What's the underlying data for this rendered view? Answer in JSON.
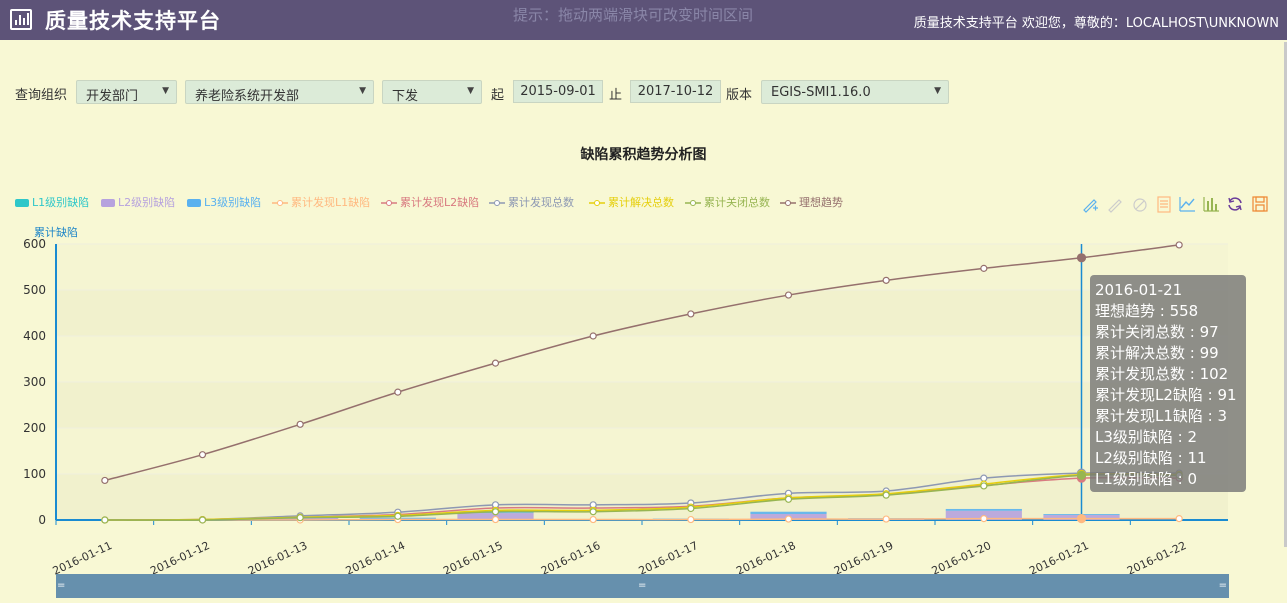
{
  "header": {
    "title": "质量技术支持平台",
    "hint": "提示：拖动两端滑块可改变时间区间",
    "user_info": "质量技术支持平台 欢迎您，尊敬的：LOCALHOST\\UNKNOWN"
  },
  "filters": {
    "org_label": "查询组织",
    "dept_type": "开发部门",
    "dept": "养老险系统开发部",
    "status": "下发",
    "start_label": "起",
    "start_date": "2015-09-01",
    "end_label": "止",
    "end_date": "2017-10-12",
    "version_label": "版本",
    "version": "EGIS-SMI1.16.0"
  },
  "toolbox_icons": [
    "zoom-icon",
    "zoom-reset-icon",
    "restore-icon",
    "data-view-icon",
    "line-chart-icon",
    "bar-chart-icon",
    "refresh-icon",
    "save-image-icon"
  ],
  "chart_data": {
    "type": "line",
    "title": "缺陷累积趋势分析图",
    "ylabel": "累计缺陷",
    "ylim": [
      0,
      600
    ],
    "yticks": [
      0,
      100,
      200,
      300,
      400,
      500,
      600
    ],
    "grid": true,
    "legend_position": "top-left",
    "categories": [
      "2016-01-11",
      "2016-01-12",
      "2016-01-13",
      "2016-01-14",
      "2016-01-15",
      "2016-01-16",
      "2016-01-17",
      "2016-01-18",
      "2016-01-19",
      "2016-01-20",
      "2016-01-21",
      "2016-01-22"
    ],
    "series": [
      {
        "name": "L1级别缺陷",
        "kind": "bar",
        "color": "#2ec7c9",
        "values": [
          0,
          0,
          0,
          0,
          0,
          0,
          0,
          0,
          0,
          0,
          0,
          0
        ]
      },
      {
        "name": "L2级别缺陷",
        "kind": "bar",
        "color": "#b6a2de",
        "values": [
          0,
          0,
          5,
          3,
          15,
          0,
          2,
          13,
          3,
          20,
          11,
          0
        ]
      },
      {
        "name": "L3级别缺陷",
        "kind": "bar",
        "color": "#5ab1ef",
        "values": [
          0,
          0,
          1,
          2,
          2,
          0,
          1,
          5,
          1,
          4,
          2,
          0
        ]
      },
      {
        "name": "累计发现L1缺陷",
        "kind": "line",
        "color": "#ffb980",
        "values": [
          0,
          0,
          0,
          1,
          1,
          1,
          1,
          2,
          2,
          3,
          3,
          3
        ]
      },
      {
        "name": "累计发现L2缺陷",
        "kind": "line",
        "color": "#d87a80",
        "values": [
          0,
          1,
          6,
          12,
          26,
          26,
          30,
          48,
          55,
          75,
          91,
          91
        ]
      },
      {
        "name": "累计发现总数",
        "kind": "line",
        "color": "#8d98b3",
        "values": [
          0,
          1,
          9,
          17,
          33,
          33,
          37,
          58,
          63,
          91,
          102,
          102
        ]
      },
      {
        "name": "累计解决总数",
        "kind": "line",
        "color": "#e5cf0d",
        "values": [
          0,
          1,
          6,
          10,
          21,
          21,
          28,
          48,
          57,
          78,
          99,
          99
        ]
      },
      {
        "name": "累计关闭总数",
        "kind": "line",
        "color": "#97b552",
        "values": [
          0,
          0,
          5,
          8,
          18,
          18,
          25,
          45,
          54,
          74,
          97,
          97
        ]
      },
      {
        "name": "理想趋势",
        "kind": "line",
        "color": "#95706d",
        "values": [
          86,
          142,
          208,
          278,
          341,
          400,
          448,
          489,
          521,
          547,
          570,
          598
        ]
      }
    ],
    "tooltip": {
      "date": "2016-01-21",
      "rows": [
        "理想趋势 : 558",
        "累计关闭总数 : 97",
        "累计解决总数 : 99",
        "累计发现总数 : 102",
        "累计发现L2缺陷 : 91",
        "累计发现L1缺陷 : 3",
        "L3级别缺陷 : 2",
        "L2级别缺陷 : 11",
        "L1级别缺陷 : 0"
      ]
    }
  }
}
